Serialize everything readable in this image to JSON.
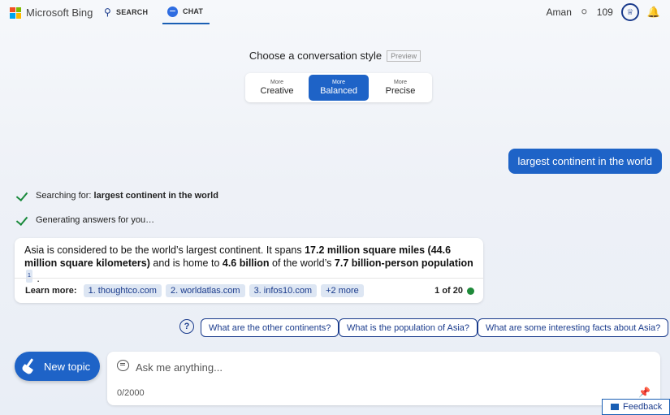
{
  "header": {
    "logo_text": "Microsoft Bing",
    "nav_search": "SEARCH",
    "nav_chat": "CHAT",
    "user_name": "Aman",
    "reward_points": "109",
    "colors": {
      "ms_red": "#f25022",
      "ms_green": "#7fba00",
      "ms_blue": "#00a4ef",
      "ms_yellow": "#ffb900"
    }
  },
  "conversation_style": {
    "title": "Choose a conversation style",
    "preview": "Preview",
    "options": [
      {
        "small": "More",
        "label": "Creative"
      },
      {
        "small": "More",
        "label": "Balanced"
      },
      {
        "small": "More",
        "label": "Precise"
      }
    ],
    "selected": "Balanced"
  },
  "user_message": "largest continent in the world",
  "status": {
    "searching_prefix": "Searching for: ",
    "searching_query": "largest continent in the world",
    "generating": "Generating answers for you…"
  },
  "answer": {
    "t1": "Asia is considered to be the world’s largest continent. It spans ",
    "b1": "17.2 million square miles (44.6 million square kilometers)",
    "t2": " and is home to ",
    "b2": "4.6 billion",
    "t3": " of the world’s ",
    "b3": "7.7 billion-person population",
    "sup": "1",
    "t4": " .",
    "learn_more_label": "Learn more:",
    "sources": [
      "1. thoughtco.com",
      "2. worldatlas.com",
      "3. infos10.com",
      "+2 more"
    ],
    "page_count": "1 of 20"
  },
  "suggestions": [
    "What are the other continents?",
    "What is the population of Asia?",
    "What are some interesting facts about Asia?"
  ],
  "new_topic_label": "New topic",
  "input": {
    "placeholder": "Ask me anything...",
    "counter": "0/2000"
  },
  "feedback_label": "Feedback",
  "accent_color": "#1e63c7"
}
